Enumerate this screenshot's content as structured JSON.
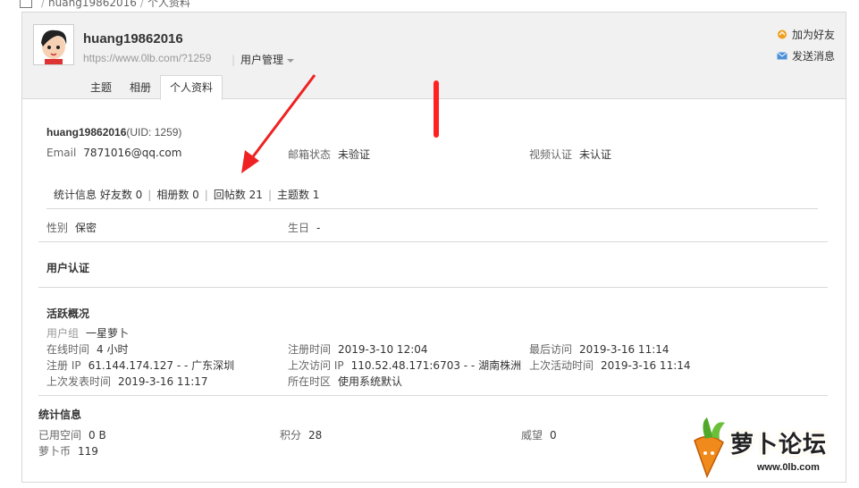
{
  "breadcrumb": {
    "user": "huang19862016",
    "page": "个人资料"
  },
  "header": {
    "username": "huang19862016",
    "url": "https://www.0lb.com/?1259",
    "manage_label": "用户管理",
    "add_friend": "加为好友",
    "send_message": "发送消息",
    "tabs": [
      "主题",
      "相册",
      "个人资料"
    ]
  },
  "profile": {
    "name": "huang19862016",
    "uid": "(UID: 1259)",
    "email_label": "Email",
    "email": "7871016@qq.com",
    "mail_status_label": "邮箱状态",
    "mail_status": "未验证",
    "video_label": "视频认证",
    "video_status": "未认证",
    "stats_label": "统计信息",
    "friends": "好友数 0",
    "albums": "相册数 0",
    "replies": "回帖数 21",
    "threads": "主题数 1",
    "gender_label": "性别",
    "gender": "保密",
    "birthday_label": "生日",
    "birthday": "-"
  },
  "auth": {
    "title": "用户认证"
  },
  "activity": {
    "title": "活跃概况",
    "group_label": "用户组",
    "group": "一星萝卜",
    "online_label": "在线时间",
    "online": "4 小时",
    "reg_time_label": "注册时间",
    "reg_time": "2019-3-10 12:04",
    "last_visit_label": "最后访问",
    "last_visit": "2019-3-16 11:14",
    "reg_ip_label": "注册 IP",
    "reg_ip": "61.144.174.127 - - 广东深圳",
    "last_ip_label": "上次访问 IP",
    "last_ip": "110.52.48.171:6703 - - 湖南株洲",
    "last_active_label": "上次活动时间",
    "last_active": "2019-3-16 11:14",
    "last_post_label": "上次发表时间",
    "last_post": "2019-3-16 11:17",
    "timezone_label": "所在时区",
    "timezone": "使用系统默认"
  },
  "statistics": {
    "title": "统计信息",
    "space_label": "已用空间",
    "space": "0 B",
    "points_label": "积分",
    "points": "28",
    "prestige_label": "威望",
    "prestige": "0",
    "coin_label": "萝卜币",
    "coin": "119"
  },
  "watermark": {
    "text": "萝卜论坛",
    "url": "www.0lb.com"
  },
  "colors": {
    "annotation": "#ee2222",
    "header_bg": "#f1f1f1",
    "border": "#d7d7d7"
  }
}
